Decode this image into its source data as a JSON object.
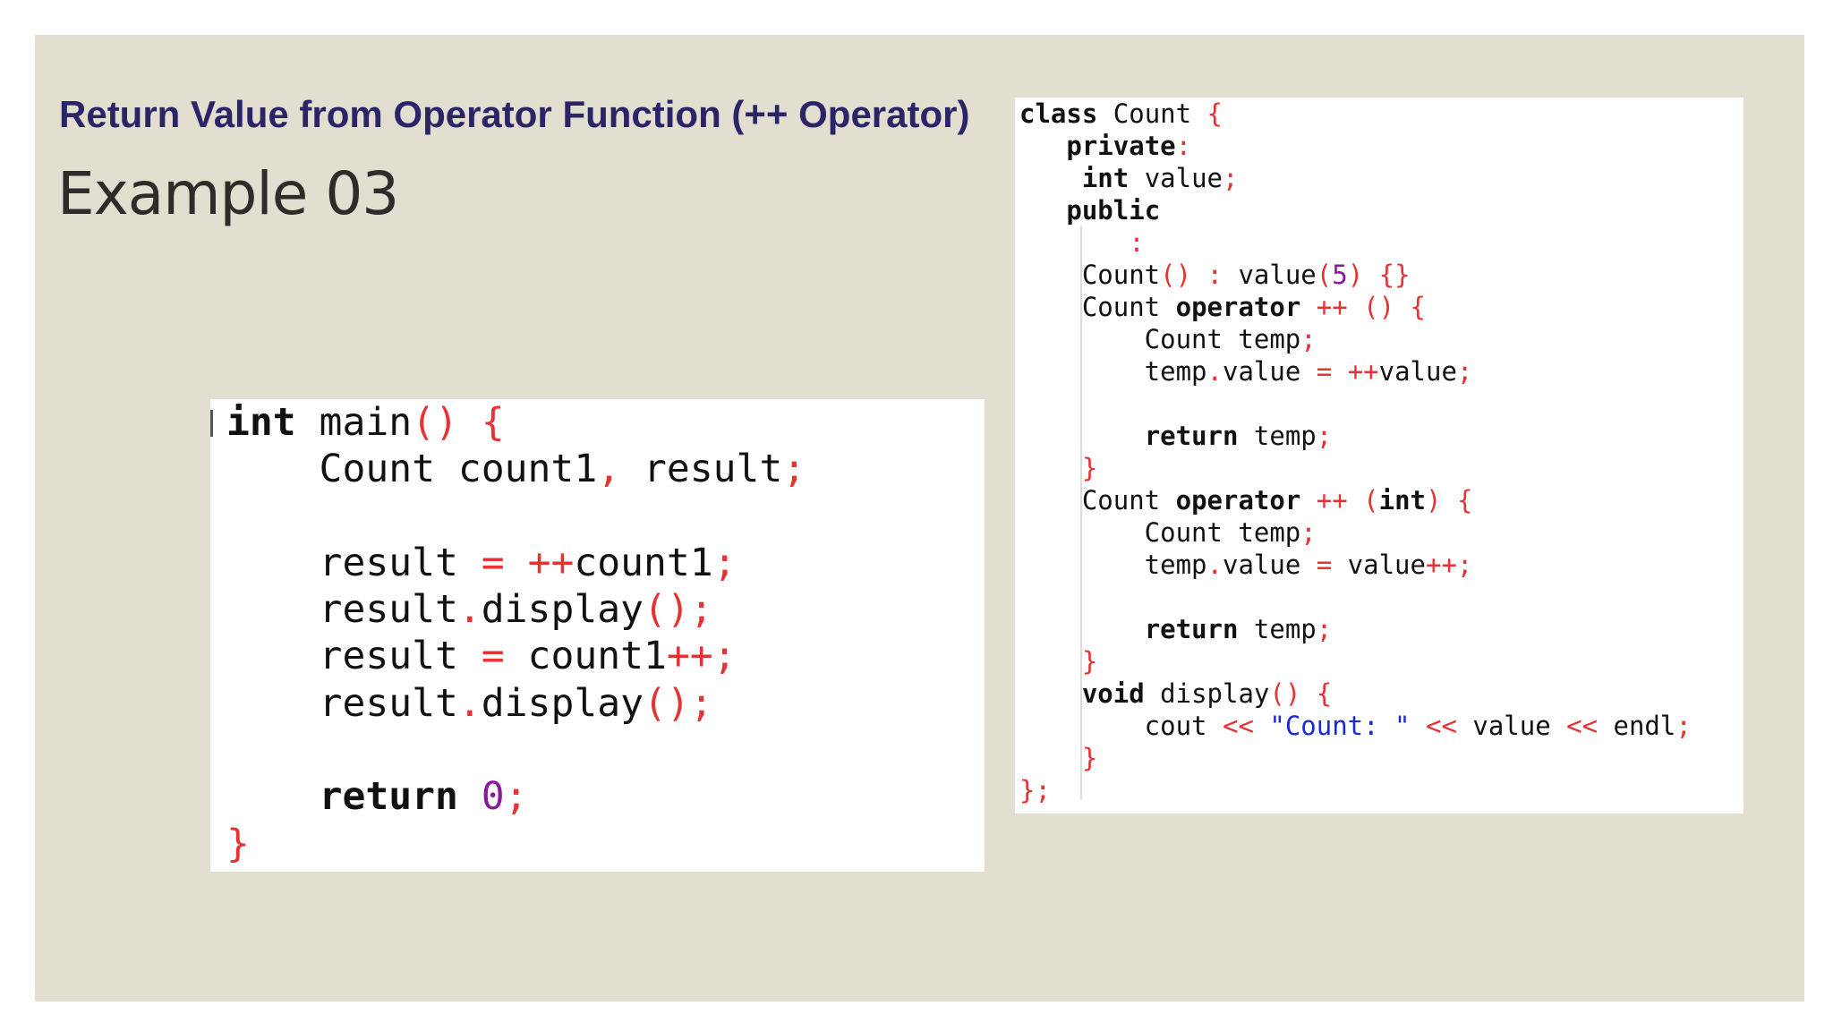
{
  "slide": {
    "title": "Return Value from Operator Function (++ Operator)",
    "subtitle": "Example 03"
  },
  "colors": {
    "slide_background": "#e2dfd1",
    "title": "#2b2567",
    "subtitle": "#2f2b28",
    "code_operator_red": "#e53232",
    "code_number_purple": "#8a1a9c",
    "code_string_blue": "#1a2ad8"
  },
  "main_code": {
    "language": "C++",
    "lines": [
      [
        {
          "t": "int",
          "c": "kw"
        },
        {
          "t": " main"
        },
        {
          "t": "()",
          "c": "op"
        },
        {
          "t": " "
        },
        {
          "t": "{",
          "c": "op"
        }
      ],
      [
        {
          "t": "    Count count1"
        },
        {
          "t": ",",
          "c": "op"
        },
        {
          "t": " result"
        },
        {
          "t": ";",
          "c": "op"
        }
      ],
      [],
      [
        {
          "t": "    result "
        },
        {
          "t": "=",
          "c": "op"
        },
        {
          "t": " "
        },
        {
          "t": "++",
          "c": "op"
        },
        {
          "t": "count1"
        },
        {
          "t": ";",
          "c": "op"
        }
      ],
      [
        {
          "t": "    result"
        },
        {
          "t": ".",
          "c": "op"
        },
        {
          "t": "display"
        },
        {
          "t": "();",
          "c": "op"
        }
      ],
      [
        {
          "t": "    result "
        },
        {
          "t": "=",
          "c": "op"
        },
        {
          "t": " count1"
        },
        {
          "t": "++;",
          "c": "op"
        }
      ],
      [
        {
          "t": "    result"
        },
        {
          "t": ".",
          "c": "op"
        },
        {
          "t": "display"
        },
        {
          "t": "();",
          "c": "op"
        }
      ],
      [],
      [
        {
          "t": "    "
        },
        {
          "t": "return",
          "c": "kw"
        },
        {
          "t": " "
        },
        {
          "t": "0",
          "c": "num"
        },
        {
          "t": ";",
          "c": "op"
        }
      ],
      [
        {
          "t": "}",
          "c": "op"
        }
      ]
    ]
  },
  "class_code": {
    "language": "C++",
    "lines": [
      [
        {
          "t": "class",
          "c": "kw"
        },
        {
          "t": " Count "
        },
        {
          "t": "{",
          "c": "op"
        }
      ],
      [
        {
          "t": "   "
        },
        {
          "t": "private",
          "c": "kw"
        },
        {
          "t": ":",
          "c": "op"
        }
      ],
      [
        {
          "t": "    "
        },
        {
          "t": "int",
          "c": "kw"
        },
        {
          "t": " value"
        },
        {
          "t": ";",
          "c": "op"
        }
      ],
      [
        {
          "t": "   "
        },
        {
          "t": "public",
          "c": "kw"
        }
      ],
      [
        {
          "t": "       "
        },
        {
          "t": ":",
          "c": "op"
        }
      ],
      [
        {
          "t": "    Count"
        },
        {
          "t": "()",
          "c": "op"
        },
        {
          "t": " "
        },
        {
          "t": ":",
          "c": "op"
        },
        {
          "t": " value"
        },
        {
          "t": "(",
          "c": "op"
        },
        {
          "t": "5",
          "c": "num"
        },
        {
          "t": ")",
          "c": "op"
        },
        {
          "t": " "
        },
        {
          "t": "{}",
          "c": "op"
        }
      ],
      [
        {
          "t": "    Count "
        },
        {
          "t": "operator",
          "c": "kw"
        },
        {
          "t": " "
        },
        {
          "t": "++",
          "c": "op"
        },
        {
          "t": " "
        },
        {
          "t": "()",
          "c": "op"
        },
        {
          "t": " "
        },
        {
          "t": "{",
          "c": "op"
        }
      ],
      [
        {
          "t": "        Count temp"
        },
        {
          "t": ";",
          "c": "op"
        }
      ],
      [
        {
          "t": "        temp"
        },
        {
          "t": ".",
          "c": "op"
        },
        {
          "t": "value "
        },
        {
          "t": "=",
          "c": "op"
        },
        {
          "t": " "
        },
        {
          "t": "++",
          "c": "op"
        },
        {
          "t": "value"
        },
        {
          "t": ";",
          "c": "op"
        }
      ],
      [],
      [
        {
          "t": "        "
        },
        {
          "t": "return",
          "c": "kw"
        },
        {
          "t": " temp"
        },
        {
          "t": ";",
          "c": "op"
        }
      ],
      [
        {
          "t": "    "
        },
        {
          "t": "}",
          "c": "op"
        }
      ],
      [
        {
          "t": "    Count "
        },
        {
          "t": "operator",
          "c": "kw"
        },
        {
          "t": " "
        },
        {
          "t": "++",
          "c": "op"
        },
        {
          "t": " "
        },
        {
          "t": "(",
          "c": "op"
        },
        {
          "t": "int",
          "c": "kw"
        },
        {
          "t": ")",
          "c": "op"
        },
        {
          "t": " "
        },
        {
          "t": "{",
          "c": "op"
        }
      ],
      [
        {
          "t": "        Count temp"
        },
        {
          "t": ";",
          "c": "op"
        }
      ],
      [
        {
          "t": "        temp"
        },
        {
          "t": ".",
          "c": "op"
        },
        {
          "t": "value "
        },
        {
          "t": "=",
          "c": "op"
        },
        {
          "t": " value"
        },
        {
          "t": "++;",
          "c": "op"
        }
      ],
      [],
      [
        {
          "t": "        "
        },
        {
          "t": "return",
          "c": "kw"
        },
        {
          "t": " temp"
        },
        {
          "t": ";",
          "c": "op"
        }
      ],
      [
        {
          "t": "    "
        },
        {
          "t": "}",
          "c": "op"
        }
      ],
      [
        {
          "t": "    "
        },
        {
          "t": "void",
          "c": "kw"
        },
        {
          "t": " display"
        },
        {
          "t": "()",
          "c": "op"
        },
        {
          "t": " "
        },
        {
          "t": "{",
          "c": "op"
        }
      ],
      [
        {
          "t": "        cout "
        },
        {
          "t": "<<",
          "c": "op"
        },
        {
          "t": " "
        },
        {
          "t": "\"Count: \"",
          "c": "str"
        },
        {
          "t": " "
        },
        {
          "t": "<<",
          "c": "op"
        },
        {
          "t": " value "
        },
        {
          "t": "<<",
          "c": "op"
        },
        {
          "t": " endl"
        },
        {
          "t": ";",
          "c": "op"
        }
      ],
      [
        {
          "t": "    "
        },
        {
          "t": "}",
          "c": "op"
        }
      ],
      [
        {
          "t": "};",
          "c": "op"
        }
      ]
    ]
  }
}
